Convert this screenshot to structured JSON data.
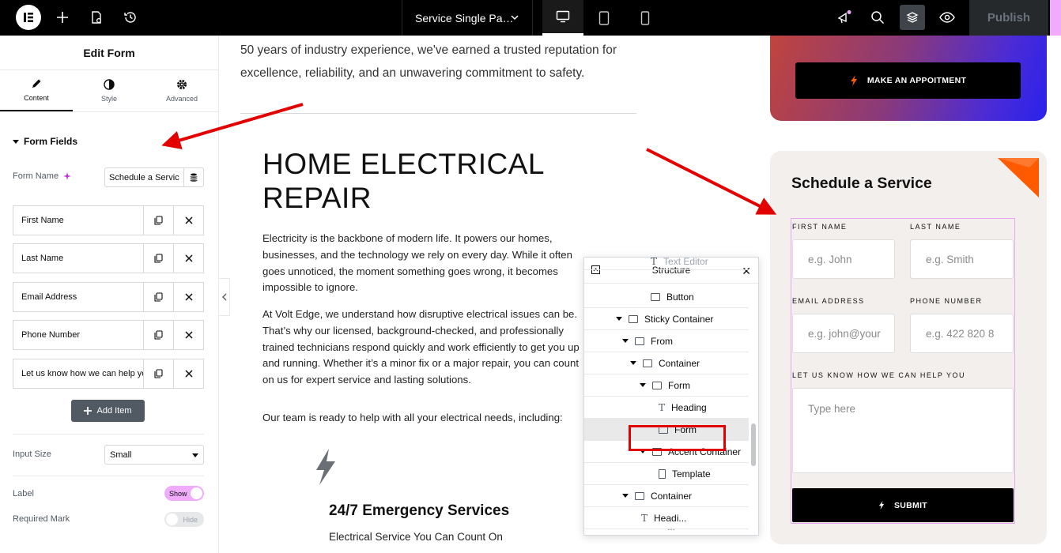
{
  "topbar": {
    "doc_title": "Service Single Pa…",
    "publish_label": "Publish",
    "icons": [
      "elementor-logo-icon",
      "plus-icon",
      "page-settings-icon",
      "history-icon",
      "chevron-down-icon",
      "desktop-icon",
      "tablet-icon",
      "mobile-icon",
      "whats-new-icon",
      "search-icon",
      "layers-icon",
      "eye-icon"
    ]
  },
  "panel": {
    "title": "Edit Form",
    "tabs": [
      {
        "label": "Content",
        "icon": "pencil-icon"
      },
      {
        "label": "Style",
        "icon": "half-circle-icon"
      },
      {
        "label": "Advanced",
        "icon": "gear-icon"
      }
    ],
    "section_title": "Form Fields",
    "form_name_label": "Form Name",
    "form_name_value": "Schedule a Servic",
    "fields": [
      "First Name",
      "Last Name",
      "Email Address",
      "Phone Number",
      "Let us know how we can help yo"
    ],
    "add_item_label": "Add Item",
    "input_size_label": "Input Size",
    "input_size_value": "Small",
    "label_label": "Label",
    "label_toggle": "Show",
    "required_label": "Required Mark",
    "required_toggle": "Hide"
  },
  "canvas": {
    "intro": "50 years of industry experience, we've earned a trusted reputation for excellence, reliability, and an unwavering commitment to safety.",
    "heading": "HOME ELECTRICAL REPAIR",
    "p1": "Electricity is the backbone of modern life. It powers our homes, businesses, and the technology we rely on every day. While it often goes unnoticed, the moment something goes wrong, it becomes impossible to ignore.",
    "p2": "At Volt Edge, we understand how disruptive electrical issues can be. That’s why our licensed, background-checked, and professionally trained technicians respond quickly and work efficiently to get you up and running. Whether it’s a minor fix or a major repair, you can count on us for expert service and lasting solutions.",
    "p3": "Our team is ready to help with all your electrical needs, including:",
    "service_title": "24/7 Emergency Services",
    "service_sub": "Electrical Service You Can Count On",
    "cta_label": "MAKE AN APPOITMENT"
  },
  "schedule": {
    "title": "Schedule a Service",
    "first_name_label": "FIRST NAME",
    "first_name_placeholder": "e.g. John",
    "last_name_label": "LAST NAME",
    "last_name_placeholder": "e.g. Smith",
    "email_label": "EMAIL ADDRESS",
    "email_placeholder": "e.g. john@your",
    "phone_label": "PHONE NUMBER",
    "phone_placeholder": "e.g. 422 820 8",
    "message_label": "LET US KNOW HOW WE CAN HELP YOU",
    "message_placeholder": "Type here",
    "submit_label": "SUBMIT"
  },
  "structure": {
    "title": "Structure",
    "rows": [
      {
        "label": "Text Editor",
        "level": 4,
        "type": "text",
        "expandable": false
      },
      {
        "label": "Button",
        "level": 4,
        "type": "widget",
        "expandable": false
      },
      {
        "label": "Sticky Container",
        "level": 1,
        "type": "container",
        "expandable": true
      },
      {
        "label": "From",
        "level": 2,
        "type": "container",
        "expandable": true
      },
      {
        "label": "Container",
        "level": 3,
        "type": "container",
        "expandable": true
      },
      {
        "label": "Form",
        "level": 4,
        "type": "container",
        "expandable": true
      },
      {
        "label": "Heading",
        "level": 5,
        "type": "text",
        "expandable": false
      },
      {
        "label": "Form",
        "level": 5,
        "type": "widget",
        "expandable": false,
        "selected": true
      },
      {
        "label": "Accent Container",
        "level": 4,
        "type": "container",
        "expandable": true
      },
      {
        "label": "Template",
        "level": 5,
        "type": "doc",
        "expandable": false
      },
      {
        "label": "Container",
        "level": 2,
        "type": "container",
        "expandable": true
      },
      {
        "label": "Headi...",
        "level": 3,
        "type": "text",
        "expandable": false
      }
    ]
  },
  "colors": {
    "accent_pink": "#f0abfc",
    "annotation_red": "#e20000",
    "orange_tab": "#ff5a00",
    "card_bg": "#f3efec"
  }
}
